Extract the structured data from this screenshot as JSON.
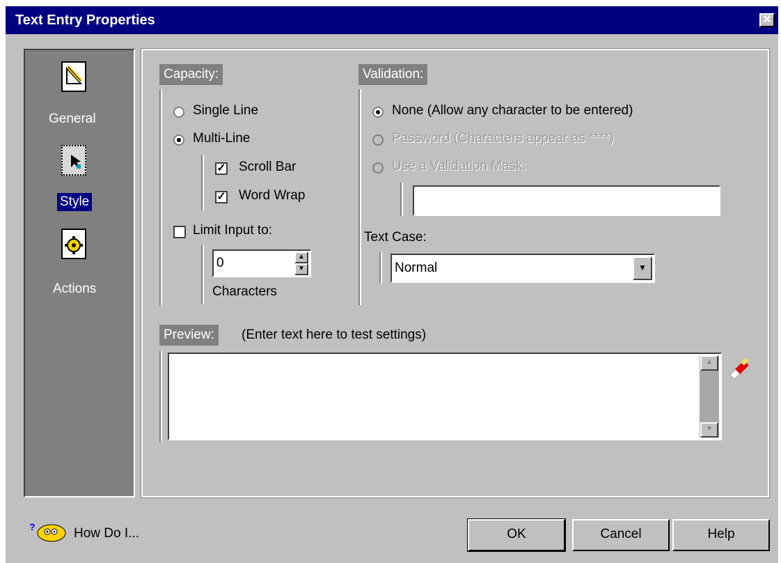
{
  "window": {
    "title": "Text Entry Properties",
    "close_glyph": "✕"
  },
  "nav": {
    "items": [
      {
        "label": "General",
        "icon": "general-pencil-icon"
      },
      {
        "label": "Style",
        "icon": "style-cursor-icon",
        "selected": true
      },
      {
        "label": "Actions",
        "icon": "actions-gear-icon"
      }
    ]
  },
  "capacity": {
    "label": "Capacity:",
    "single_line": "Single Line",
    "multi_line": "Multi-Line",
    "scroll_bar": "Scroll Bar",
    "word_wrap": "Word Wrap",
    "limit_input": "Limit Input to:",
    "limit_value": "0",
    "characters": "Characters"
  },
  "validation": {
    "label": "Validation:",
    "none": "None (Allow any character to be entered)",
    "password": "Password (Characters appear as ****)",
    "mask": "Use a Validation Mask:",
    "mask_value": ""
  },
  "text_case": {
    "label": "Text Case:",
    "value": "Normal"
  },
  "preview": {
    "label": "Preview:",
    "hint": "(Enter text here to test settings)",
    "value": ""
  },
  "footer": {
    "how_do_i": "How Do I...",
    "ok": "OK",
    "cancel": "Cancel",
    "help": "Help"
  }
}
